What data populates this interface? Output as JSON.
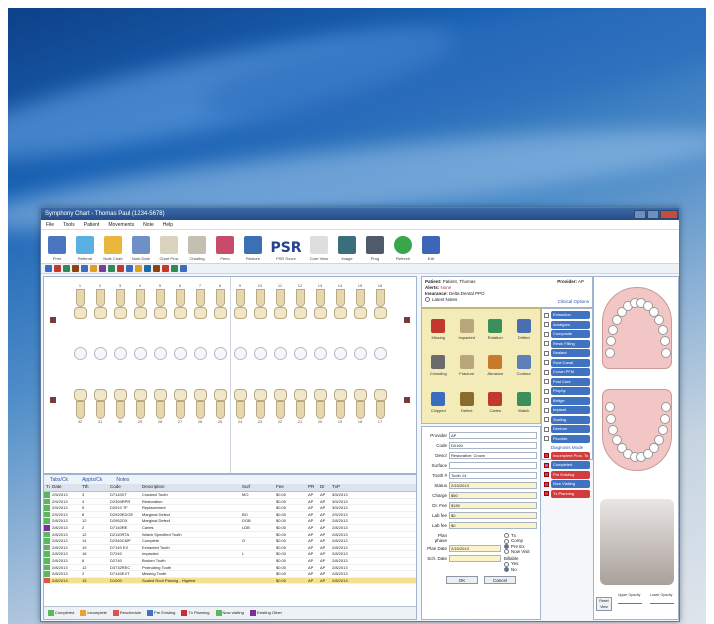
{
  "window": {
    "title": "Symphony Chart - Thomas Paul (1234-5678)"
  },
  "menu": [
    "File",
    "Tools",
    "Patient",
    "Movements",
    "Note",
    "Help"
  ],
  "toolbar": {
    "psr_label": "PSR",
    "buttons": [
      "Print",
      "Referral",
      "Note Chart",
      "Note Date",
      "Chart Proc",
      "Charting",
      "Perio",
      "Restore",
      "Cure View",
      "PSR Score",
      "Image",
      "Prog",
      "Refresh",
      "Exit"
    ]
  },
  "patient": {
    "patient_label": "Patient:",
    "patient_name": "Patient, Thomas",
    "alerts_label": "Alerts:",
    "alerts_value": "None",
    "insurance_label": "Insurance:",
    "insurance_value": "Delta Dental PPO",
    "latest_label": "Latest Notes",
    "provider_label": "Provider:",
    "provider_value": "AP",
    "clinical_options": "Clinical Options"
  },
  "chart_buttons": [
    "Missing",
    "Impacted",
    "Rotation",
    "Drifted",
    "Crowding",
    "Fracture",
    "Abrasion",
    "Contour",
    "Chipped",
    "Defect",
    "Caries",
    "Watch"
  ],
  "procedure_list": [
    "Extraction",
    "Amalgam",
    "Composite",
    "Resin Filling",
    "Sealant",
    "Root Canal",
    "Crown PFM",
    "Post Core",
    "Prophy",
    "Bridge",
    "Implant",
    "Scaling",
    "Denture",
    "Fluoride"
  ],
  "diagnosis": {
    "label": "Diagnosis Mode",
    "items": [
      "Incomplete Proc. To",
      "Completed",
      "Pre Existing",
      "Now Visiting",
      "Tx Planning"
    ]
  },
  "form": {
    "fields": [
      {
        "label": "Provider",
        "value": "AP"
      },
      {
        "label": "Code",
        "value": "D0160"
      },
      {
        "label": "Descr",
        "value": "Restorative: Crown"
      },
      {
        "label": "Surface",
        "value": ""
      },
      {
        "label": "Tooth #",
        "value": "Tooth 14"
      },
      {
        "label": "Status",
        "value": "2/15/2013"
      },
      {
        "label": "Charge",
        "value": "$50"
      },
      {
        "label": "Dr. Fee",
        "value": "$150"
      },
      {
        "label": "Lab fee",
        "value": "$0"
      },
      {
        "label": "Lab fee",
        "value": "$0"
      }
    ],
    "radios_top": [
      "Tx",
      "Comp",
      "Pre Ex",
      "Now Visit"
    ],
    "plan_phase_label": "Plan phase",
    "plan_date_label": "Plan Date",
    "plan_date": "2/15/2013",
    "sched_date_label": "Sch. Date",
    "sched_date": "",
    "billable_label": "Billable",
    "billable_options": [
      "Yes",
      "No"
    ],
    "ok": "OK",
    "cancel": "Cancel"
  },
  "teeth_upper": [
    "1",
    "2",
    "3",
    "4",
    "5",
    "6",
    "7",
    "8",
    "9",
    "10",
    "11",
    "12",
    "13",
    "14",
    "15",
    "16"
  ],
  "teeth_lower": [
    "32",
    "31",
    "30",
    "29",
    "28",
    "27",
    "26",
    "25",
    "24",
    "23",
    "22",
    "21",
    "20",
    "19",
    "18",
    "17"
  ],
  "proc_tabs": [
    "Tabs/Ck",
    "Appts/Ck",
    "Notes"
  ],
  "proc_headers": [
    "Tx",
    "Date",
    "Tth",
    "Code",
    "Description",
    "Surf",
    "Fee",
    "PR",
    "Dr",
    "TxP",
    "Sta"
  ],
  "proc_rows": [
    [
      "2/5/2013",
      "3",
      "D7140XT",
      "Cracked Tooth",
      "MO",
      "$0.00",
      "AP",
      "3/5/2013"
    ],
    [
      "2/5/2013",
      "4",
      "D2394RPR",
      "Restoration",
      "",
      "$0.00",
      "AP",
      "3/5/2013"
    ],
    [
      "2/5/2013",
      "5",
      "D2910 TF",
      "Replacement",
      "",
      "$0.00",
      "AP",
      "3/5/2013"
    ],
    [
      "2/5/2013",
      "8",
      "D2920EDGE",
      "Marginal Defect",
      "BO",
      "$0.00",
      "AP",
      "2/5/2013"
    ],
    [
      "2/8/2013",
      "12",
      "D2952OX",
      "Marginal Defect",
      "DOB",
      "$0.00",
      "AP",
      "2/8/2013"
    ],
    [
      "2/8/2013",
      "2",
      "D7140RE",
      "Caries",
      "LDB",
      "$0.00",
      "AP",
      "2/8/2013"
    ],
    [
      "2/8/2013",
      "12",
      "D2110RTA",
      "Watch Specified Tooth",
      "",
      "$0.00",
      "AP",
      "2/8/2013"
    ],
    [
      "2/8/2013",
      "14",
      "D2340CMP",
      "Complete",
      "O",
      "$0.00",
      "AP",
      "2/8/2013"
    ],
    [
      "2/8/2013",
      "19",
      "D7140 EX",
      "Extracted Tooth",
      "",
      "$0.00",
      "AP",
      "2/8/2013"
    ],
    [
      "2/8/2013",
      "16",
      "D7240",
      "Impacted",
      "L",
      "$0.00",
      "AP",
      "2/8/2013"
    ],
    [
      "2/8/2013",
      "6",
      "D2740",
      "Broken Tooth",
      "",
      "$0.00",
      "AP",
      "2/8/2013"
    ],
    [
      "2/8/2013",
      "12",
      "D3732REC",
      "Protruding Tooth",
      "",
      "$0.00",
      "AP",
      "2/8/2013"
    ],
    [
      "2/8/2013",
      "2",
      "D7140EXT",
      "Missing Tooth",
      "",
      "$0.00",
      "AP",
      "2/8/2013"
    ],
    [
      "2/8/2013",
      "15",
      "D1000",
      "Scaled Root Planing - Highest",
      "",
      "$0.00",
      "AP",
      "2/8/2013"
    ]
  ],
  "legend": [
    "Completed",
    "Incomplete",
    "Reschedule",
    "Pre Existing",
    "Tx Planning",
    "Now visiting",
    "Existing Other"
  ],
  "model": {
    "reset": "Reset View",
    "opacity_upper": "Upper Opacity",
    "opacity_lower": "Lower Opacity"
  },
  "colors": {
    "accent": "#3f73c2",
    "tooth": "#f0e6c8",
    "gum": "#f2c6c4",
    "selected_row": "#f6e08e"
  }
}
